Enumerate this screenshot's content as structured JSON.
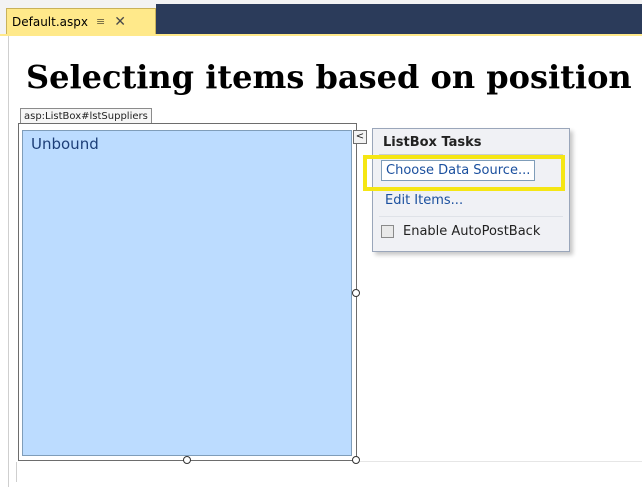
{
  "tab": {
    "label": "Default.aspx",
    "pin_icon": "pin-icon",
    "close_icon": "close-icon"
  },
  "page": {
    "heading": "Selecting items based on position"
  },
  "control": {
    "tag_label": "asp:ListBox#lstSuppliers",
    "items": [
      "Unbound"
    ]
  },
  "smart_tag": {
    "glyph": "<",
    "title": "ListBox Tasks",
    "tasks": [
      "Choose Data Source...",
      "Edit Items..."
    ],
    "checkbox_label": "Enable AutoPostBack",
    "checkbox_checked": false
  },
  "colors": {
    "tab_active": "#ffe98a",
    "listbox_bg": "#bcdcff",
    "highlight": "#f5e614",
    "link": "#1a4f9e"
  }
}
